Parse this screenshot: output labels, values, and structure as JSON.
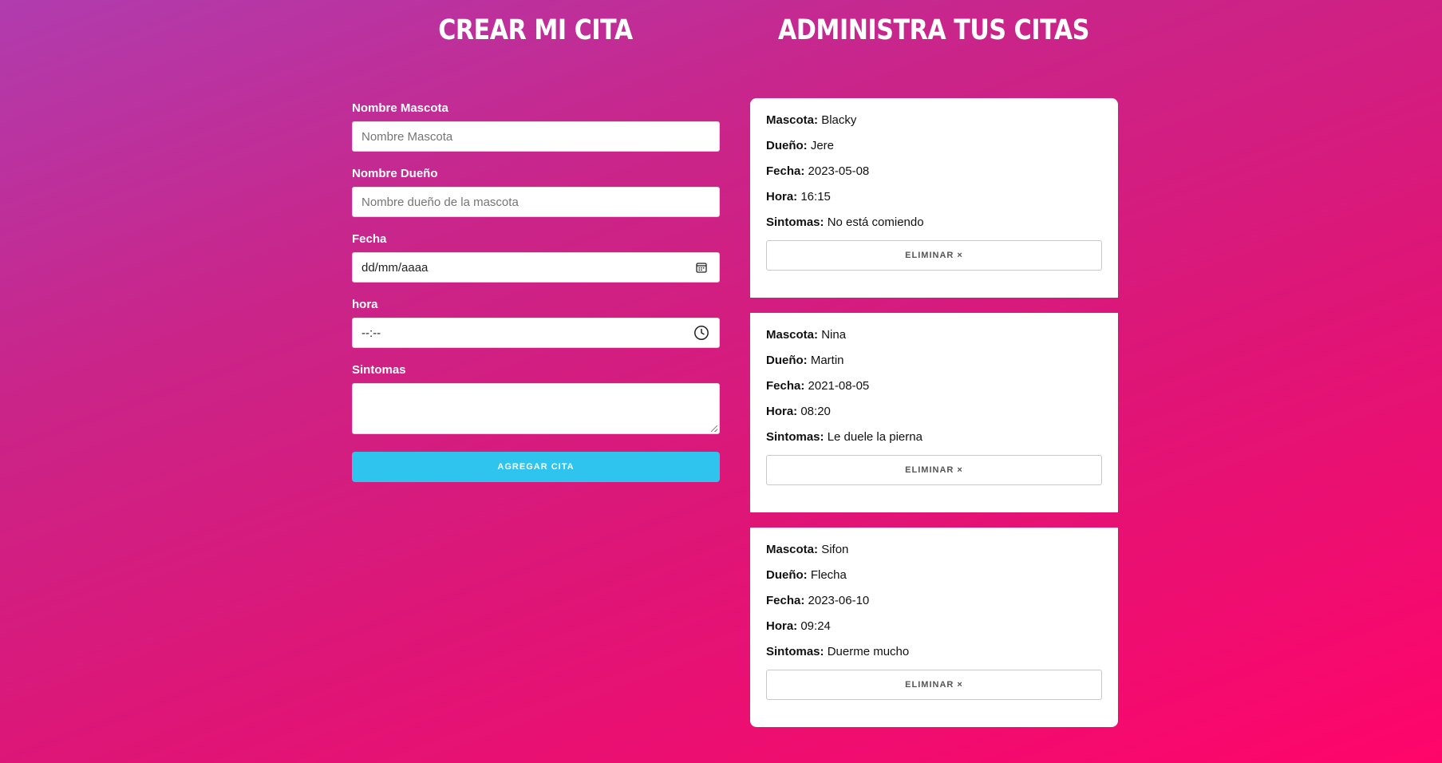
{
  "headings": {
    "create": "Crear mi cita",
    "manage": "Administra tus citas"
  },
  "form": {
    "pet_label": "Nombre Mascota",
    "pet_placeholder": "Nombre Mascota",
    "owner_label": "Nombre Dueño",
    "owner_placeholder": "Nombre dueño de la mascota",
    "date_label": "Fecha",
    "date_value": "dd/mm/aaaa",
    "date_icon": "calendar-icon",
    "time_label": "hora",
    "time_value": "--:--",
    "time_icon": "clock-icon",
    "symptoms_label": "Sintomas",
    "symptoms_value": "",
    "submit_label": "Agregar cita"
  },
  "card_keys": {
    "pet": "Mascota:",
    "owner": "Dueño:",
    "date": "Fecha:",
    "time": "Hora:",
    "symptoms": "Sintomas:"
  },
  "appointments": [
    {
      "pet": "Blacky",
      "owner": "Jere",
      "date": "2023-05-08",
      "time": "16:15",
      "symptoms": "No está comiendo",
      "delete_label": "Eliminar ×"
    },
    {
      "pet": "Nina",
      "owner": "Martin",
      "date": "2021-08-05",
      "time": "08:20",
      "symptoms": "Le duele la pierna",
      "delete_label": "Eliminar ×"
    },
    {
      "pet": "Sifon",
      "owner": "Flecha",
      "date": "2023-06-10",
      "time": "09:24",
      "symptoms": "Duerme mucho",
      "delete_label": "Eliminar ×"
    }
  ],
  "colors": {
    "accent": "#2ec4ee",
    "bg_start": "#b03cae",
    "bg_end": "#ff056a"
  }
}
